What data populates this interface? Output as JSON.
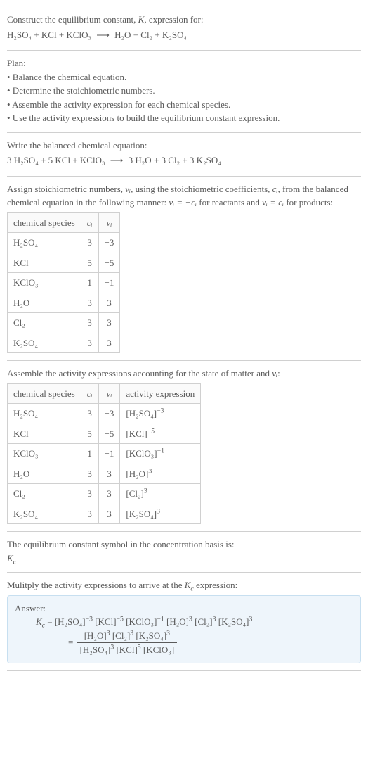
{
  "intro": {
    "line1_pre": "Construct the equilibrium constant, ",
    "line1_K": "K",
    "line1_post": ", expression for:",
    "eq_lhs": "H₂SO₄ + KCl + KClO₃",
    "eq_arrow": "⟶",
    "eq_rhs": "H₂O + Cl₂ + K₂SO₄"
  },
  "plan": {
    "title": "Plan:",
    "b1": "• Balance the chemical equation.",
    "b2": "• Determine the stoichiometric numbers.",
    "b3": "• Assemble the activity expression for each chemical species.",
    "b4": "• Use the activity expressions to build the equilibrium constant expression."
  },
  "balanced": {
    "title": "Write the balanced chemical equation:",
    "eq_lhs": "3 H₂SO₄ + 5 KCl + KClO₃",
    "eq_arrow": "⟶",
    "eq_rhs": "3 H₂O + 3 Cl₂ + 3 K₂SO₄"
  },
  "stoich": {
    "intro_a": "Assign stoichiometric numbers, ",
    "intro_b": ", using the stoichiometric coefficients, ",
    "intro_c": ", from the balanced chemical equation in the following manner: ",
    "intro_d": " for reactants and ",
    "intro_e": " for products:",
    "nu_i": "νᵢ",
    "c_i": "cᵢ",
    "rel_react": "νᵢ = −cᵢ",
    "rel_prod": "νᵢ = cᵢ",
    "headers": {
      "species": "chemical species",
      "ci": "cᵢ",
      "vi": "νᵢ"
    },
    "rows": [
      {
        "sp": "H₂SO₄",
        "c": "3",
        "v": "−3"
      },
      {
        "sp": "KCl",
        "c": "5",
        "v": "−5"
      },
      {
        "sp": "KClO₃",
        "c": "1",
        "v": "−1"
      },
      {
        "sp": "H₂O",
        "c": "3",
        "v": "3"
      },
      {
        "sp": "Cl₂",
        "c": "3",
        "v": "3"
      },
      {
        "sp": "K₂SO₄",
        "c": "3",
        "v": "3"
      }
    ]
  },
  "activity": {
    "intro_a": "Assemble the activity expressions accounting for the state of matter and ",
    "intro_b": ":",
    "nu_i": "νᵢ",
    "headers": {
      "species": "chemical species",
      "ci": "cᵢ",
      "vi": "νᵢ",
      "act": "activity expression"
    },
    "rows": [
      {
        "sp": "H₂SO₄",
        "c": "3",
        "v": "−3",
        "base": "[H₂SO₄]",
        "exp": "−3"
      },
      {
        "sp": "KCl",
        "c": "5",
        "v": "−5",
        "base": "[KCl]",
        "exp": "−5"
      },
      {
        "sp": "KClO₃",
        "c": "1",
        "v": "−1",
        "base": "[KClO₃]",
        "exp": "−1"
      },
      {
        "sp": "H₂O",
        "c": "3",
        "v": "3",
        "base": "[H₂O]",
        "exp": "3"
      },
      {
        "sp": "Cl₂",
        "c": "3",
        "v": "3",
        "base": "[Cl₂]",
        "exp": "3"
      },
      {
        "sp": "K₂SO₄",
        "c": "3",
        "v": "3",
        "base": "[K₂SO₄]",
        "exp": "3"
      }
    ]
  },
  "symbol": {
    "line": "The equilibrium constant symbol in the concentration basis is:",
    "kc_base": "K",
    "kc_sub": "c"
  },
  "multiply": {
    "line_a": "Mulitply the activity expressions to arrive at the ",
    "line_b": " expression:",
    "kc_base": "K",
    "kc_sub": "c"
  },
  "answer": {
    "label": "Answer:",
    "kc_base": "K",
    "kc_sub": "c",
    "terms": [
      {
        "b": "[H₂SO₄]",
        "e": "−3"
      },
      {
        "b": "[KCl]",
        "e": "−5"
      },
      {
        "b": "[KClO₃]",
        "e": "−1"
      },
      {
        "b": "[H₂O]",
        "e": "3"
      },
      {
        "b": "[Cl₂]",
        "e": "3"
      },
      {
        "b": "[K₂SO₄]",
        "e": "3"
      }
    ],
    "eq_sign": " = ",
    "num": [
      {
        "b": "[H₂O]",
        "e": "3"
      },
      {
        "b": "[Cl₂]",
        "e": "3"
      },
      {
        "b": "[K₂SO₄]",
        "e": "3"
      }
    ],
    "den": [
      {
        "b": "[H₂SO₄]",
        "e": "3"
      },
      {
        "b": "[KCl]",
        "e": "5"
      },
      {
        "b": "[KClO₃]",
        "e": ""
      }
    ]
  }
}
